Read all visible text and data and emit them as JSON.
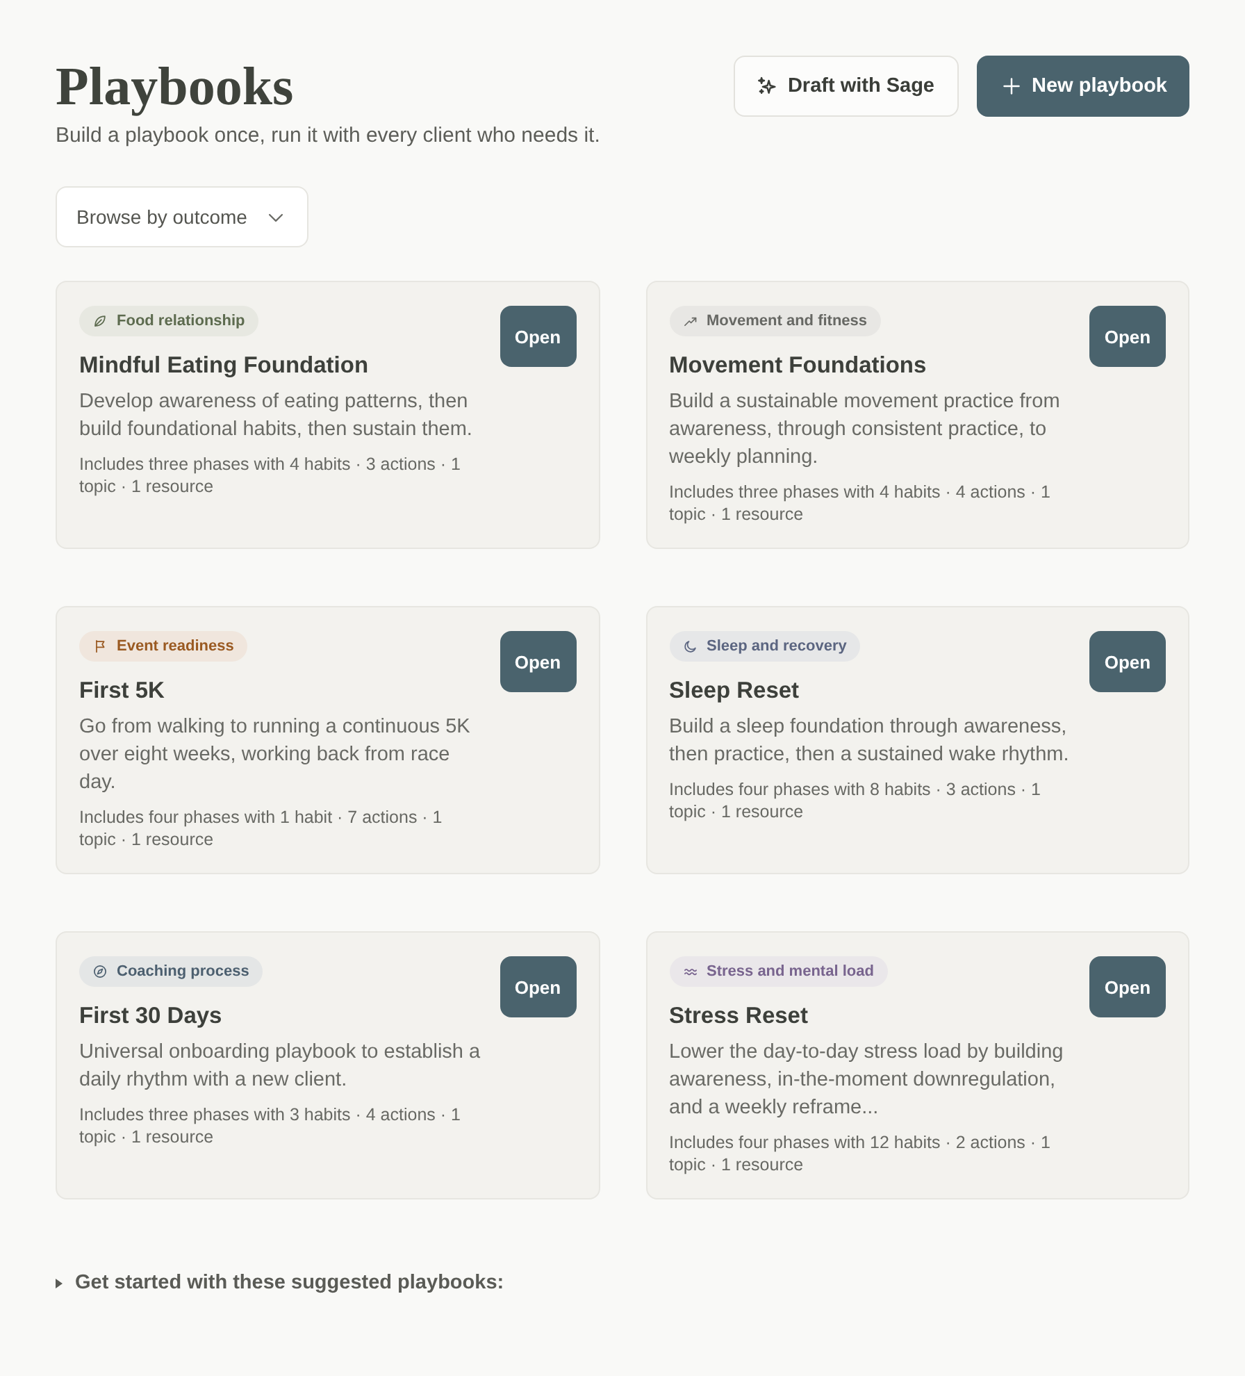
{
  "page": {
    "title": "Playbooks",
    "subtitle": "Build a playbook once, run it with every client who needs it."
  },
  "actions": [
    {
      "label": "Draft with Sage",
      "kind": "secondary"
    },
    {
      "label": "New playbook",
      "kind": "primary"
    }
  ],
  "filter": {
    "label": "Browse by outcome"
  },
  "playbooks": [
    {
      "tag": {
        "label": "Food relationship",
        "color": "#5d6b4f"
      },
      "title": "Mindful Eating Foundation",
      "description": "Develop awareness of eating patterns, then build foundational habits, then sustain them.",
      "summary": "Includes three phases with 4 habits · 3 actions · 1 topic · 1 resource",
      "button": "Open"
    },
    {
      "tag": {
        "label": "Movement and fitness",
        "color": "#676864"
      },
      "title": "Movement Foundations",
      "description": "Build a sustainable movement practice from awareness, through consistent practice, to weekly planning.",
      "summary": "Includes three phases with 4 habits · 4 actions · 1 topic · 1 resource",
      "button": "Open"
    },
    {
      "tag": {
        "label": "Event readiness",
        "color": "#9a5a22"
      },
      "title": "First 5K",
      "description": "Go from walking to running a continuous 5K over eight weeks, working back from race day.",
      "summary": "Includes four phases with 1 habit · 7 actions · 1 topic · 1 resource",
      "button": "Open"
    },
    {
      "tag": {
        "label": "Sleep and recovery",
        "color": "#5b6580"
      },
      "title": "Sleep Reset",
      "description": "Build a sleep foundation through awareness, then practice, then a sustained wake rhythm.",
      "summary": "Includes four phases with 8 habits · 3 actions · 1 topic · 1 resource",
      "button": "Open"
    },
    {
      "tag": {
        "label": "Coaching process",
        "color": "#4c5f6f"
      },
      "title": "First 30 Days",
      "description": "Universal onboarding playbook to establish a daily rhythm with a new client.",
      "summary": "Includes three phases with 3 habits · 4 actions · 1 topic · 1 resource",
      "button": "Open"
    },
    {
      "tag": {
        "label": "Stress and mental load",
        "color": "#78648e"
      },
      "title": "Stress Reset",
      "description": "Lower the day-to-day stress load by building awareness, in-the-moment downregulation, and a weekly reframe...",
      "summary": "Includes four phases with 12 habits · 2 actions · 1 topic · 1 resource",
      "button": "Open"
    }
  ],
  "suggested": {
    "label": "Get started with these suggested playbooks:",
    "expanded": false
  }
}
